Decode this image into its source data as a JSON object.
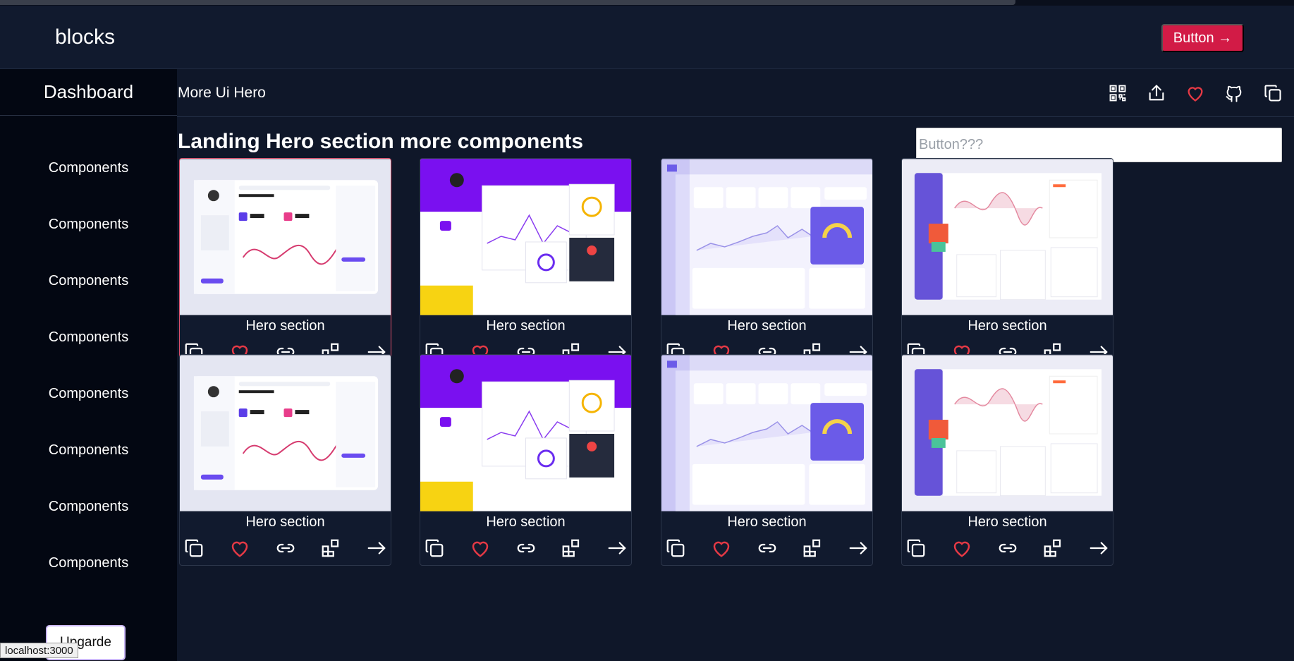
{
  "header": {
    "brand": "blocks",
    "cta_label": "Button →"
  },
  "sidebar": {
    "title": "Dashboard",
    "items": [
      {
        "label": "Components"
      },
      {
        "label": "Components"
      },
      {
        "label": "Components"
      },
      {
        "label": "Components"
      },
      {
        "label": "Components"
      },
      {
        "label": "Components"
      },
      {
        "label": "Components"
      },
      {
        "label": "Components"
      }
    ],
    "upgrade_label": "Upgarde"
  },
  "status_bar": {
    "url": "localhost:3000"
  },
  "subbar": {
    "title": "More Ui Hero",
    "icons": [
      "qr-code-icon",
      "share-icon",
      "heart-icon",
      "github-icon",
      "copy-icon"
    ]
  },
  "main": {
    "section_title": "Landing Hero section more components",
    "search": {
      "placeholder": "Button???",
      "value": ""
    }
  },
  "cards": [
    {
      "title": "Hero section",
      "thumb": "dashboard-light",
      "active": true
    },
    {
      "title": "Hero section",
      "thumb": "dashboard-purple"
    },
    {
      "title": "Hero section",
      "thumb": "dashboard-lavender"
    },
    {
      "title": "Hero section",
      "thumb": "dashboard-sidebar"
    },
    {
      "title": "Hero section",
      "thumb": "dashboard-light"
    },
    {
      "title": "Hero section",
      "thumb": "dashboard-purple"
    },
    {
      "title": "Hero section",
      "thumb": "dashboard-lavender"
    },
    {
      "title": "Hero section",
      "thumb": "dashboard-sidebar"
    }
  ],
  "card_actions": [
    "copy-icon",
    "heart-icon",
    "link-icon",
    "blocks-icon",
    "arrow-right-icon"
  ],
  "colors": {
    "accent": "#d21b46",
    "heart": "#e53945",
    "bg": "#0f1729",
    "sidebar": "#030712"
  }
}
